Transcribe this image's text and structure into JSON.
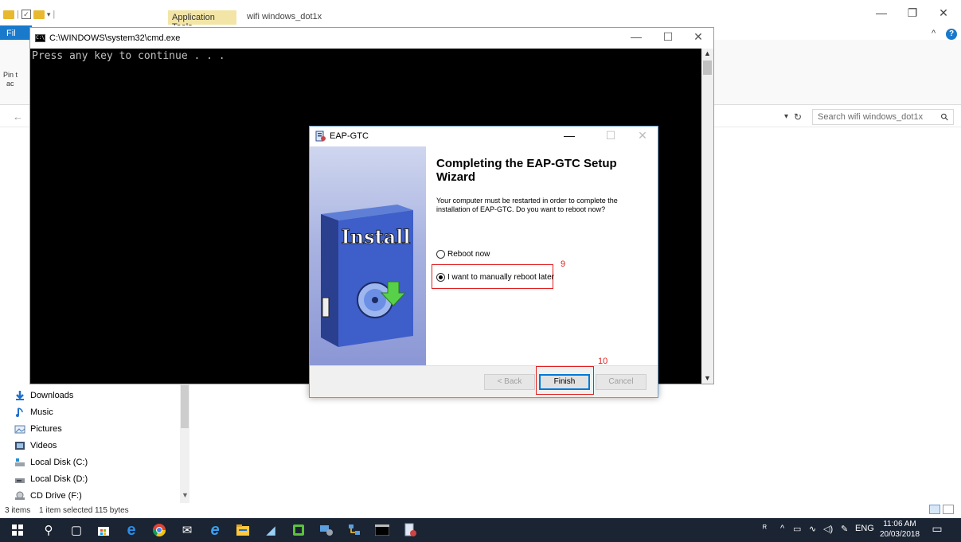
{
  "explorer": {
    "app_tools_tab": "Application Tools",
    "title": "wifi windows_dot1x",
    "file_tab": "Fil",
    "pin_text_line1": "Pin t",
    "pin_text_line2": "ac",
    "search_placeholder": "Search wifi windows_dot1x",
    "nav_items": [
      {
        "label": "Downloads",
        "icon": "download-icon"
      },
      {
        "label": "Music",
        "icon": "music-icon"
      },
      {
        "label": "Pictures",
        "icon": "pictures-icon"
      },
      {
        "label": "Videos",
        "icon": "videos-icon"
      },
      {
        "label": "Local Disk (C:)",
        "icon": "disk-icon"
      },
      {
        "label": "Local Disk (D:)",
        "icon": "disk-icon"
      },
      {
        "label": "CD Drive (F:)",
        "icon": "cd-drive-icon"
      }
    ],
    "status_items": "3 items",
    "status_selected": "1 item selected  115 bytes"
  },
  "cmd": {
    "title": "C:\\WINDOWS\\system32\\cmd.exe",
    "output": "Press any key to continue . . ."
  },
  "dialog": {
    "title": "EAP-GTC",
    "heading": "Completing the EAP-GTC Setup Wizard",
    "description": "Your computer must be restarted in order to complete the installation of EAP-GTC. Do you want to reboot now?",
    "side_image_text": "Install",
    "options": [
      {
        "label": "Reboot now",
        "selected": false
      },
      {
        "label": "I want to manually reboot later",
        "selected": true
      }
    ],
    "buttons": {
      "back": "< Back",
      "finish": "Finish",
      "cancel": "Cancel"
    },
    "annotation_9": "9",
    "annotation_10": "10"
  },
  "taskbar": {
    "icons": [
      "windows-start-icon",
      "search-icon",
      "task-view-icon",
      "store-icon",
      "edge-icon",
      "chrome-icon",
      "mail-icon",
      "ie-icon",
      "file-explorer-icon",
      "app-icon",
      "app-icon-2",
      "network-app-icon",
      "network-icon",
      "terminal-icon",
      "installer-icon"
    ],
    "language": "ENG",
    "time": "11:06 AM",
    "date": "20/03/2018"
  },
  "colors": {
    "accent": "#0078d7",
    "annotation": "#e02020",
    "taskbar": "#1a2433",
    "app_tools": "#f3e5a6"
  }
}
